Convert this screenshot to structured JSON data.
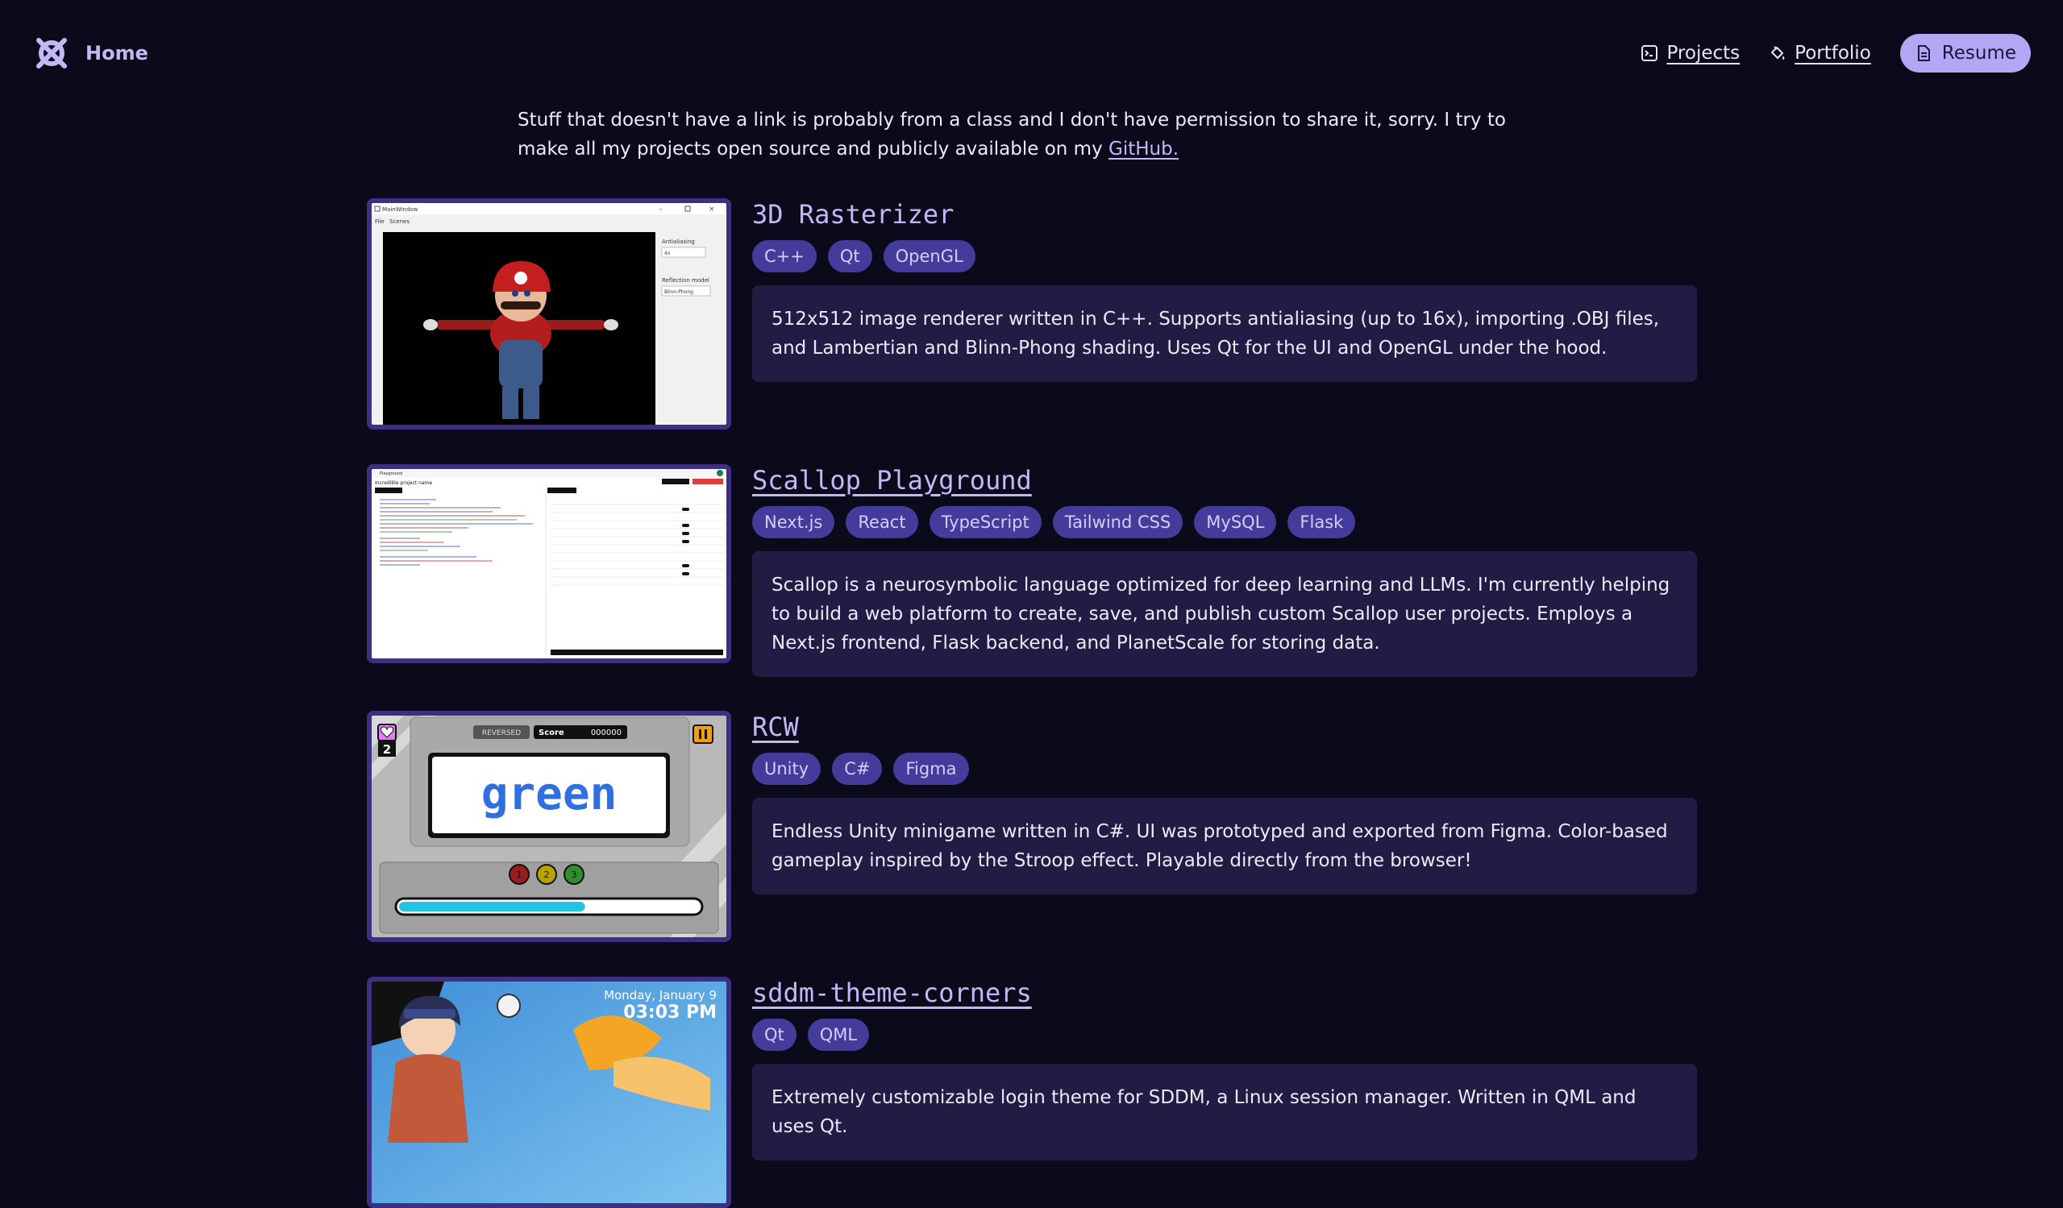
{
  "nav": {
    "home_label": "Home",
    "links": [
      {
        "label": "Projects",
        "icon": "terminal-icon"
      },
      {
        "label": "Portfolio",
        "icon": "paint-bucket-icon"
      }
    ],
    "resume_label": "Resume",
    "resume_icon": "document-icon"
  },
  "intro": {
    "text": "Stuff that doesn't have a link is probably from a class and I don't have permission to share it, sorry. I try to make all my projects open source and publicly available on my ",
    "link_label": "GitHub."
  },
  "projects": [
    {
      "title": "3D Rasterizer",
      "tags": [
        "C++",
        "Qt",
        "OpenGL"
      ],
      "description": "512x512 image renderer written in C++. Supports antialiasing (up to 16x), importing .OBJ files, and Lambertian and Blinn-Phong shading. Uses Qt for the UI and OpenGL under the hood.",
      "screenshot": {
        "window_title": "MainWindow",
        "menu": [
          "File",
          "Scenes"
        ],
        "antialiasing_label": "Antialiasing",
        "antialiasing_value": "4x",
        "reflection_label": "Reflection model",
        "reflection_value": "Blinn-Phong"
      }
    },
    {
      "title": "Scallop Playground",
      "tags": [
        "Next.js",
        "React",
        "TypeScript",
        "Tailwind CSS",
        "MySQL",
        "Flask"
      ],
      "description": "Scallop is a neurosymbolic language optimized for deep learning and LLMs. I'm currently helping to build a web platform to create, save, and publish custom Scallop user projects. Employs a Next.js frontend, Flask backend, and PlanetScale for storing data.",
      "screenshot": {
        "app_name": "Playground",
        "project_name": "Incredible project name"
      }
    },
    {
      "title": "RCW",
      "tags": [
        "Unity",
        "C#",
        "Figma"
      ],
      "description": "Endless Unity minigame written in C#. UI was prototyped and exported from Figma. Color-based gameplay inspired by the Stroop effect. Playable directly from the browser!",
      "screenshot": {
        "lives": "2",
        "reversed_label": "REVERSED",
        "score_label": "Score",
        "score_value": "000000",
        "word": "green",
        "buttons": [
          "1",
          "2",
          "3"
        ],
        "progress": 0.62
      }
    },
    {
      "title": "sddm-theme-corners",
      "tags": [
        "Qt",
        "QML"
      ],
      "description": "Extremely customizable login theme for SDDM, a Linux session manager. Written in QML and uses Qt.",
      "screenshot": {
        "date": "Monday, January 9",
        "time": "03:03 PM"
      }
    }
  ],
  "colors": {
    "background": "#0b0a1b",
    "accent": "#c3b8f7",
    "tag_bg": "#443c9a",
    "card_bg": "#221c44",
    "thumb_border": "#3e2f83"
  }
}
